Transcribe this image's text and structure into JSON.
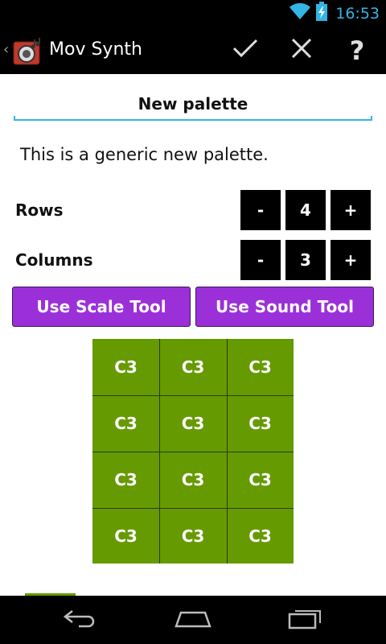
{
  "status_bar": {
    "time": "16:53",
    "icons": [
      "wifi-icon",
      "battery-charging-icon"
    ]
  },
  "action_bar": {
    "title": "Mov Synth",
    "app_icon": "mov-synth-app-icon",
    "up_indicator": "‹",
    "actions": [
      {
        "name": "confirm",
        "icon": "checkmark-icon"
      },
      {
        "name": "cancel",
        "icon": "close-icon"
      },
      {
        "name": "help",
        "icon": "help-icon",
        "glyph": "?"
      }
    ]
  },
  "palette": {
    "name": "New palette",
    "description": "This is a generic new palette."
  },
  "rows": {
    "label": "Rows",
    "minus": "-",
    "value": "4",
    "plus": "+"
  },
  "columns": {
    "label": "Columns",
    "minus": "-",
    "value": "3",
    "plus": "+"
  },
  "tools": {
    "scale": "Use Scale Tool",
    "sound": "Use Sound Tool"
  },
  "grid": {
    "cells": [
      [
        "C3",
        "C3",
        "C3"
      ],
      [
        "C3",
        "C3",
        "C3"
      ],
      [
        "C3",
        "C3",
        "C3"
      ],
      [
        "C3",
        "C3",
        "C3"
      ]
    ],
    "cell_color": "#659a00"
  },
  "colors": {
    "accent": "#33b5e5",
    "tool_button": "#9b30d9",
    "cell": "#659a00"
  },
  "nav_bar": {
    "buttons": [
      "back-icon",
      "home-icon",
      "recent-apps-icon"
    ]
  }
}
